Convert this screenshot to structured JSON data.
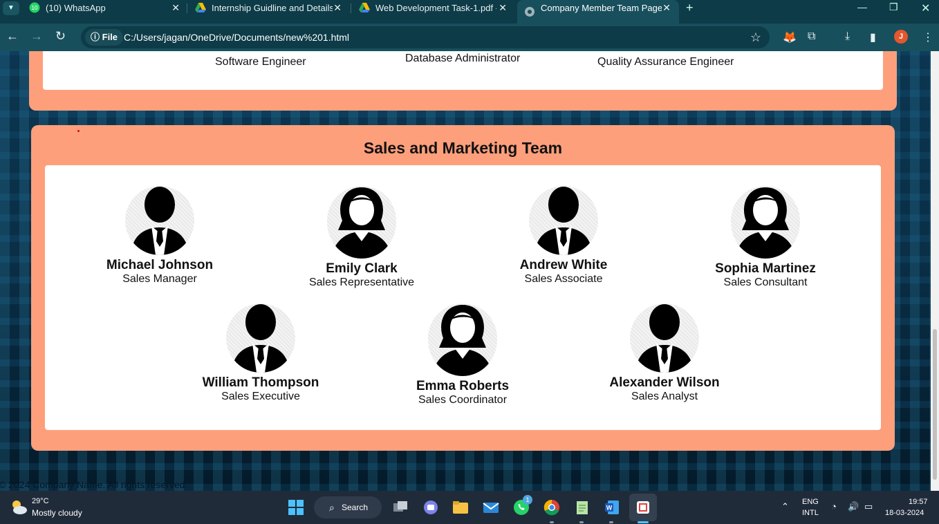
{
  "browser": {
    "tabs": [
      {
        "title": "(10) WhatsApp",
        "icon": "whatsapp-icon",
        "badge": "10"
      },
      {
        "title": "Internship Guidline and Details.",
        "icon": "google-drive-icon"
      },
      {
        "title": "Web Development Task-1.pdf -",
        "icon": "google-drive-icon"
      },
      {
        "title": "Company Member Team Page",
        "icon": "globe-icon",
        "active": true
      }
    ],
    "site_info_label": "File",
    "url": "C:/Users/jagan/OneDrive/Documents/new%201.html",
    "profile_initial": "J"
  },
  "page": {
    "previous_team_roles": [
      "Software Engineer",
      "Database Administrator",
      "Quality Assurance Engineer"
    ],
    "section_title": "Sales and Marketing Team",
    "members": [
      {
        "name": "Michael Johnson",
        "role": "Sales Manager",
        "avatar": "male-avatar-icon"
      },
      {
        "name": "Emily Clark",
        "role": "Sales Representative",
        "avatar": "female-avatar-icon"
      },
      {
        "name": "Andrew White",
        "role": "Sales Associate",
        "avatar": "male-avatar-icon"
      },
      {
        "name": "Sophia Martinez",
        "role": "Sales Consultant",
        "avatar": "female-avatar-icon"
      },
      {
        "name": "William Thompson",
        "role": "Sales Executive",
        "avatar": "male-avatar-icon"
      },
      {
        "name": "Emma Roberts",
        "role": "Sales Coordinator",
        "avatar": "female-avatar-icon"
      },
      {
        "name": "Alexander Wilson",
        "role": "Sales Analyst",
        "avatar": "male-avatar-icon"
      }
    ],
    "footer": "© 2024 Company Name. All rights reserved."
  },
  "taskbar": {
    "weather_temp": "29°C",
    "weather_desc": "Mostly cloudy",
    "search_label": "Search",
    "whatsapp_badge": "1",
    "lang_top": "ENG",
    "lang_bottom": "INTL",
    "time": "19:57",
    "date": "18-03-2024"
  },
  "colors": {
    "section_bg": "#fe9f7b",
    "card_bg": "#ffffff",
    "chrome_dark": "#0d3b47",
    "chrome_toolbar": "#184f5c",
    "taskbar_bg": "#202b3a"
  }
}
